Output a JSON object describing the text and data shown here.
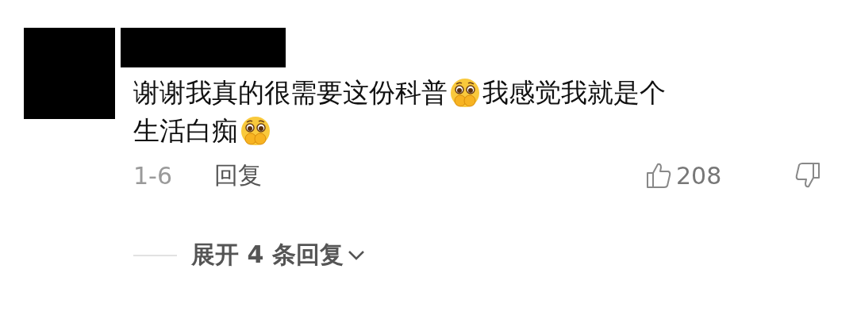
{
  "comment": {
    "lines": [
      [
        {
          "kind": "text",
          "text": "谢谢我真的很需要这份科普"
        },
        {
          "kind": "emoji"
        },
        {
          "kind": "text",
          "text": "我感觉我就是个"
        }
      ],
      [
        {
          "kind": "text",
          "text": "生活白痴"
        },
        {
          "kind": "emoji"
        }
      ]
    ],
    "date": "1-6",
    "reply": "回复",
    "likes": "208",
    "expand": "展开 4 条回复"
  }
}
